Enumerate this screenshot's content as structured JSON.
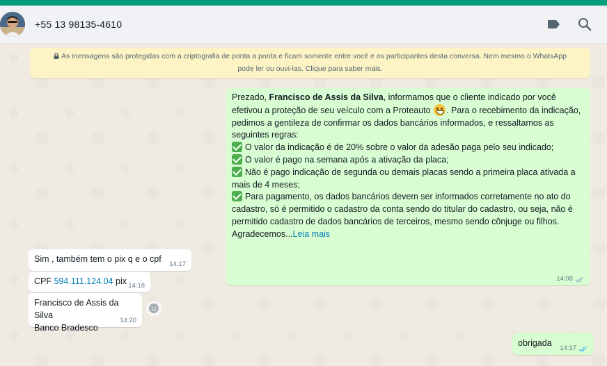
{
  "header": {
    "contact_name": "+55 13 98135-4610",
    "icons": [
      "label-icon",
      "search-icon"
    ]
  },
  "encryption_notice": {
    "line1": "As mensagens são protegidas com a criptografia de ponta a ponta e ficam somente entre você e os participantes desta conversa. Nem mesmo o WhatsApp",
    "line2": "pode ler ou ouvi-las. Clique para saber mais."
  },
  "messages": {
    "outgoing_1": {
      "greeting": "Prezado, ",
      "name": "Francisco de Assis da Silva",
      "p1a": ", informamos que o cliente indicado por você efetivou a proteção de seu veículo com a Proteauto ",
      "p1b": ". Para o recebimento da indicação, pedimos a gentileza de confirmar os dados bancários informados, e  ressaltamos as seguintes regras:",
      "rule1": "O valor da indicação é de 20% sobre o valor da adesão paga pelo seu indicado;",
      "rule2": "O valor é pago na semana após a ativação da placa;",
      "rule3": "Não é pago indicação de segunda ou demais placas sendo a primeira placa ativada a mais de 4 meses;",
      "rule4": "Para pagamento, os dados bancários devem ser informados corretamente no ato do cadastro, só é permitido o cadastro da conta sendo do titular do cadastro, ou seja, não é permitido cadastro de dados bancários de terceiros, mesmo sendo cônjuge ou filhos.",
      "closing": "Agradecemos...",
      "read_more": "Leia mais",
      "time": "14:08",
      "status": "read-ticks"
    },
    "incoming_1": {
      "text": "Sim , também tem o pix q e o cpf",
      "time": "14:17"
    },
    "incoming_2": {
      "prefix": "CPF ",
      "cpf": "594.111.124.04",
      "suffix": " pix",
      "time": "14:18"
    },
    "incoming_3": {
      "line1": "Francisco de Assis da Silva",
      "line2": "Banco Bradesco",
      "time": "14:20"
    },
    "outgoing_2": {
      "text": "obrigada",
      "time": "14:37",
      "status": "read-ticks"
    }
  },
  "colors": {
    "outgoing_bubble": "#d9fdd3",
    "incoming_bubble": "#ffffff",
    "encryption_bg": "#fdf4c5",
    "read_ticks": "#53bdeb",
    "link": "#027eb5",
    "top_strip": "#009e7c"
  }
}
